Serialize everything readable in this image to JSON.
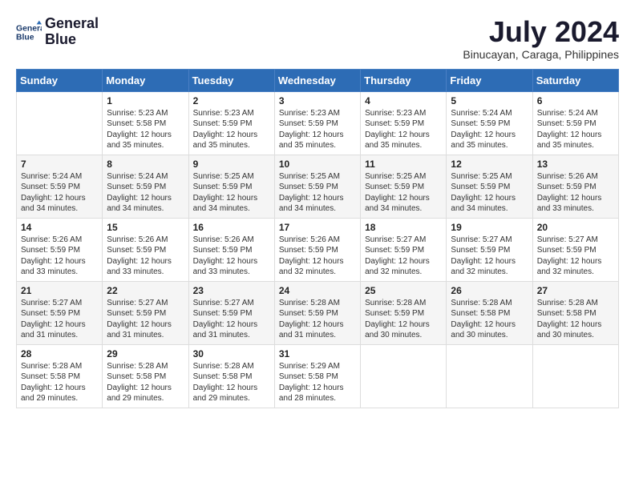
{
  "header": {
    "logo_line1": "General",
    "logo_line2": "Blue",
    "month_title": "July 2024",
    "location": "Binucayan, Caraga, Philippines"
  },
  "days_of_week": [
    "Sunday",
    "Monday",
    "Tuesday",
    "Wednesday",
    "Thursday",
    "Friday",
    "Saturday"
  ],
  "weeks": [
    [
      {
        "day": "",
        "text": ""
      },
      {
        "day": "1",
        "text": "Sunrise: 5:23 AM\nSunset: 5:58 PM\nDaylight: 12 hours\nand 35 minutes."
      },
      {
        "day": "2",
        "text": "Sunrise: 5:23 AM\nSunset: 5:59 PM\nDaylight: 12 hours\nand 35 minutes."
      },
      {
        "day": "3",
        "text": "Sunrise: 5:23 AM\nSunset: 5:59 PM\nDaylight: 12 hours\nand 35 minutes."
      },
      {
        "day": "4",
        "text": "Sunrise: 5:23 AM\nSunset: 5:59 PM\nDaylight: 12 hours\nand 35 minutes."
      },
      {
        "day": "5",
        "text": "Sunrise: 5:24 AM\nSunset: 5:59 PM\nDaylight: 12 hours\nand 35 minutes."
      },
      {
        "day": "6",
        "text": "Sunrise: 5:24 AM\nSunset: 5:59 PM\nDaylight: 12 hours\nand 35 minutes."
      }
    ],
    [
      {
        "day": "7",
        "text": "Sunrise: 5:24 AM\nSunset: 5:59 PM\nDaylight: 12 hours\nand 34 minutes."
      },
      {
        "day": "8",
        "text": "Sunrise: 5:24 AM\nSunset: 5:59 PM\nDaylight: 12 hours\nand 34 minutes."
      },
      {
        "day": "9",
        "text": "Sunrise: 5:25 AM\nSunset: 5:59 PM\nDaylight: 12 hours\nand 34 minutes."
      },
      {
        "day": "10",
        "text": "Sunrise: 5:25 AM\nSunset: 5:59 PM\nDaylight: 12 hours\nand 34 minutes."
      },
      {
        "day": "11",
        "text": "Sunrise: 5:25 AM\nSunset: 5:59 PM\nDaylight: 12 hours\nand 34 minutes."
      },
      {
        "day": "12",
        "text": "Sunrise: 5:25 AM\nSunset: 5:59 PM\nDaylight: 12 hours\nand 34 minutes."
      },
      {
        "day": "13",
        "text": "Sunrise: 5:26 AM\nSunset: 5:59 PM\nDaylight: 12 hours\nand 33 minutes."
      }
    ],
    [
      {
        "day": "14",
        "text": "Sunrise: 5:26 AM\nSunset: 5:59 PM\nDaylight: 12 hours\nand 33 minutes."
      },
      {
        "day": "15",
        "text": "Sunrise: 5:26 AM\nSunset: 5:59 PM\nDaylight: 12 hours\nand 33 minutes."
      },
      {
        "day": "16",
        "text": "Sunrise: 5:26 AM\nSunset: 5:59 PM\nDaylight: 12 hours\nand 33 minutes."
      },
      {
        "day": "17",
        "text": "Sunrise: 5:26 AM\nSunset: 5:59 PM\nDaylight: 12 hours\nand 32 minutes."
      },
      {
        "day": "18",
        "text": "Sunrise: 5:27 AM\nSunset: 5:59 PM\nDaylight: 12 hours\nand 32 minutes."
      },
      {
        "day": "19",
        "text": "Sunrise: 5:27 AM\nSunset: 5:59 PM\nDaylight: 12 hours\nand 32 minutes."
      },
      {
        "day": "20",
        "text": "Sunrise: 5:27 AM\nSunset: 5:59 PM\nDaylight: 12 hours\nand 32 minutes."
      }
    ],
    [
      {
        "day": "21",
        "text": "Sunrise: 5:27 AM\nSunset: 5:59 PM\nDaylight: 12 hours\nand 31 minutes."
      },
      {
        "day": "22",
        "text": "Sunrise: 5:27 AM\nSunset: 5:59 PM\nDaylight: 12 hours\nand 31 minutes."
      },
      {
        "day": "23",
        "text": "Sunrise: 5:27 AM\nSunset: 5:59 PM\nDaylight: 12 hours\nand 31 minutes."
      },
      {
        "day": "24",
        "text": "Sunrise: 5:28 AM\nSunset: 5:59 PM\nDaylight: 12 hours\nand 31 minutes."
      },
      {
        "day": "25",
        "text": "Sunrise: 5:28 AM\nSunset: 5:59 PM\nDaylight: 12 hours\nand 30 minutes."
      },
      {
        "day": "26",
        "text": "Sunrise: 5:28 AM\nSunset: 5:58 PM\nDaylight: 12 hours\nand 30 minutes."
      },
      {
        "day": "27",
        "text": "Sunrise: 5:28 AM\nSunset: 5:58 PM\nDaylight: 12 hours\nand 30 minutes."
      }
    ],
    [
      {
        "day": "28",
        "text": "Sunrise: 5:28 AM\nSunset: 5:58 PM\nDaylight: 12 hours\nand 29 minutes."
      },
      {
        "day": "29",
        "text": "Sunrise: 5:28 AM\nSunset: 5:58 PM\nDaylight: 12 hours\nand 29 minutes."
      },
      {
        "day": "30",
        "text": "Sunrise: 5:28 AM\nSunset: 5:58 PM\nDaylight: 12 hours\nand 29 minutes."
      },
      {
        "day": "31",
        "text": "Sunrise: 5:29 AM\nSunset: 5:58 PM\nDaylight: 12 hours\nand 28 minutes."
      },
      {
        "day": "",
        "text": ""
      },
      {
        "day": "",
        "text": ""
      },
      {
        "day": "",
        "text": ""
      }
    ]
  ]
}
